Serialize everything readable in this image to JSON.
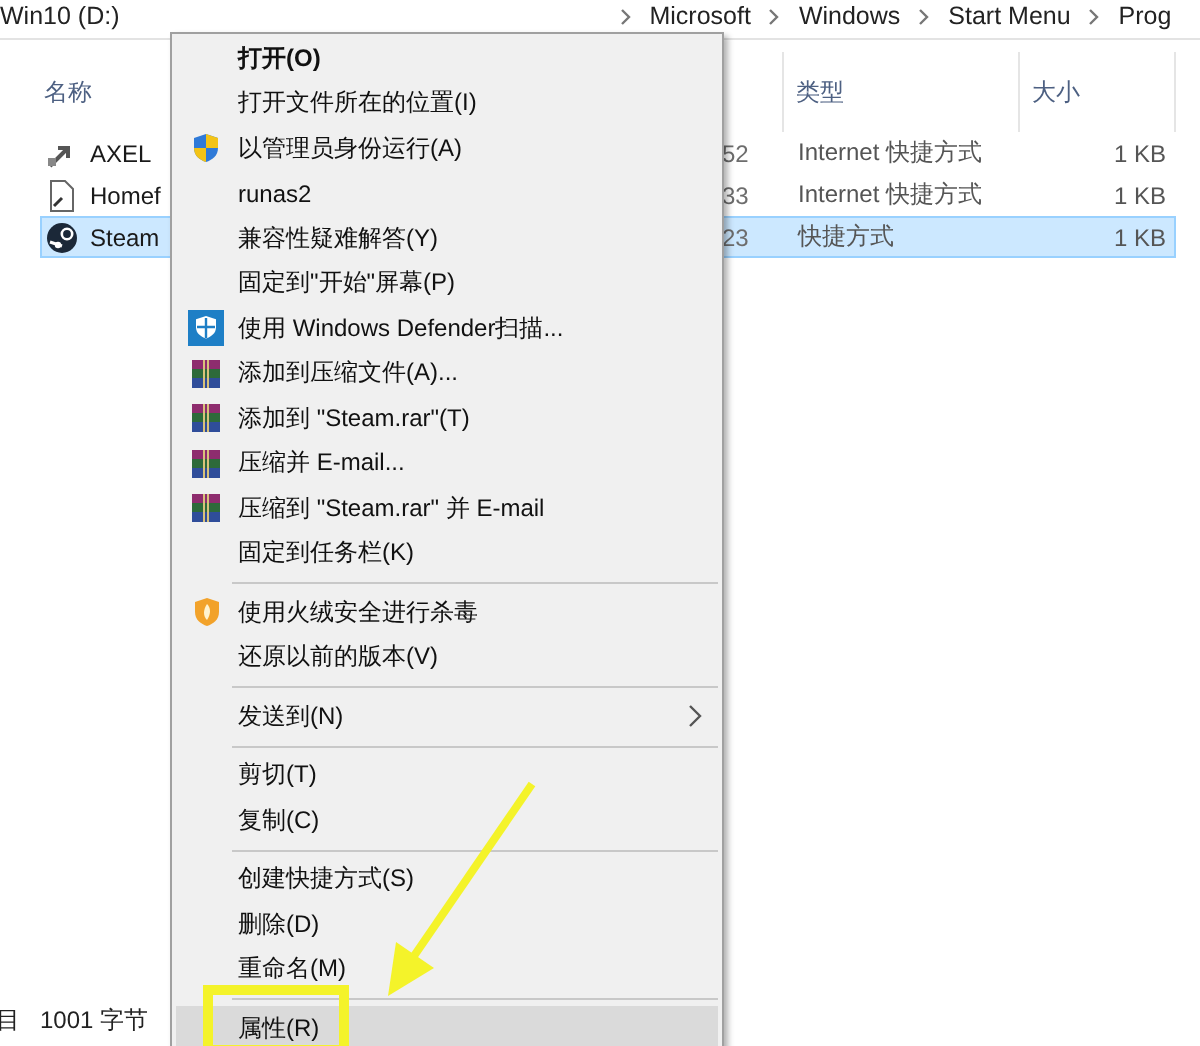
{
  "breadcrumb": [
    "Win10 (D:)",
    "Microsoft",
    "Windows",
    "Start Menu",
    "Prog"
  ],
  "columns": [
    "名称",
    "类型",
    "大小"
  ],
  "rows": [
    {
      "kind": "link",
      "name": "AXEL",
      "column_3": "52",
      "type": "Internet 快捷方式",
      "size": "1 KB",
      "selected": false
    },
    {
      "kind": "file",
      "name": "Homef",
      "column_3": "33",
      "type": "Internet 快捷方式",
      "size": "1 KB",
      "selected": false
    },
    {
      "kind": "steam",
      "name": "Steam",
      "column_3": "23",
      "type": "快捷方式",
      "size": "1 KB",
      "selected": true
    }
  ],
  "status_bar": [
    "目",
    "1001 字节"
  ],
  "context_menu": [
    {
      "kind": "plain",
      "label": "打开(O)",
      "default": true,
      "highlighted": false
    },
    {
      "kind": "plain",
      "label": "打开文件所在的位置(I)",
      "default": false,
      "highlighted": false
    },
    {
      "kind": "uac",
      "label": "以管理员身份运行(A)",
      "default": false,
      "highlighted": false
    },
    {
      "kind": "plain",
      "label": "runas2",
      "default": false,
      "highlighted": false
    },
    {
      "kind": "plain",
      "label": "兼容性疑难解答(Y)",
      "default": false,
      "highlighted": false
    },
    {
      "kind": "plain",
      "label": "固定到\"开始\"屏幕(P)",
      "default": false,
      "highlighted": false
    },
    {
      "kind": "defender",
      "label": "使用 Windows Defender扫描...",
      "default": false,
      "highlighted": false
    },
    {
      "kind": "archive",
      "label": "添加到压缩文件(A)...",
      "default": false,
      "highlighted": false
    },
    {
      "kind": "archive",
      "label": "添加到 \"Steam.rar\"(T)",
      "default": false,
      "highlighted": false
    },
    {
      "kind": "archive",
      "label": "压缩并 E-mail...",
      "default": false,
      "highlighted": false
    },
    {
      "kind": "archive",
      "label": "压缩到 \"Steam.rar\" 并 E-mail",
      "default": false,
      "highlighted": false
    },
    {
      "kind": "plain",
      "label": "固定到任务栏(K)",
      "default": false,
      "highlighted": false
    },
    {
      "kind": "separator"
    },
    {
      "kind": "antivirus",
      "label": "使用火绒安全进行杀毒",
      "default": false,
      "highlighted": false
    },
    {
      "kind": "plain",
      "label": "还原以前的版本(V)",
      "default": false,
      "highlighted": false
    },
    {
      "kind": "separator"
    },
    {
      "kind": "submenu",
      "label": "发送到(N)",
      "default": false,
      "highlighted": false
    },
    {
      "kind": "separator"
    },
    {
      "kind": "plain",
      "label": "剪切(T)",
      "default": false,
      "highlighted": false
    },
    {
      "kind": "plain",
      "label": "复制(C)",
      "default": false,
      "highlighted": false
    },
    {
      "kind": "separator"
    },
    {
      "kind": "plain",
      "label": "创建快捷方式(S)",
      "default": false,
      "highlighted": false
    },
    {
      "kind": "plain",
      "label": "删除(D)",
      "default": false,
      "highlighted": false
    },
    {
      "kind": "plain",
      "label": "重命名(M)",
      "default": false,
      "highlighted": false
    },
    {
      "kind": "separator"
    },
    {
      "kind": "plain",
      "label": "属性(R)",
      "default": false,
      "highlighted": true
    }
  ]
}
